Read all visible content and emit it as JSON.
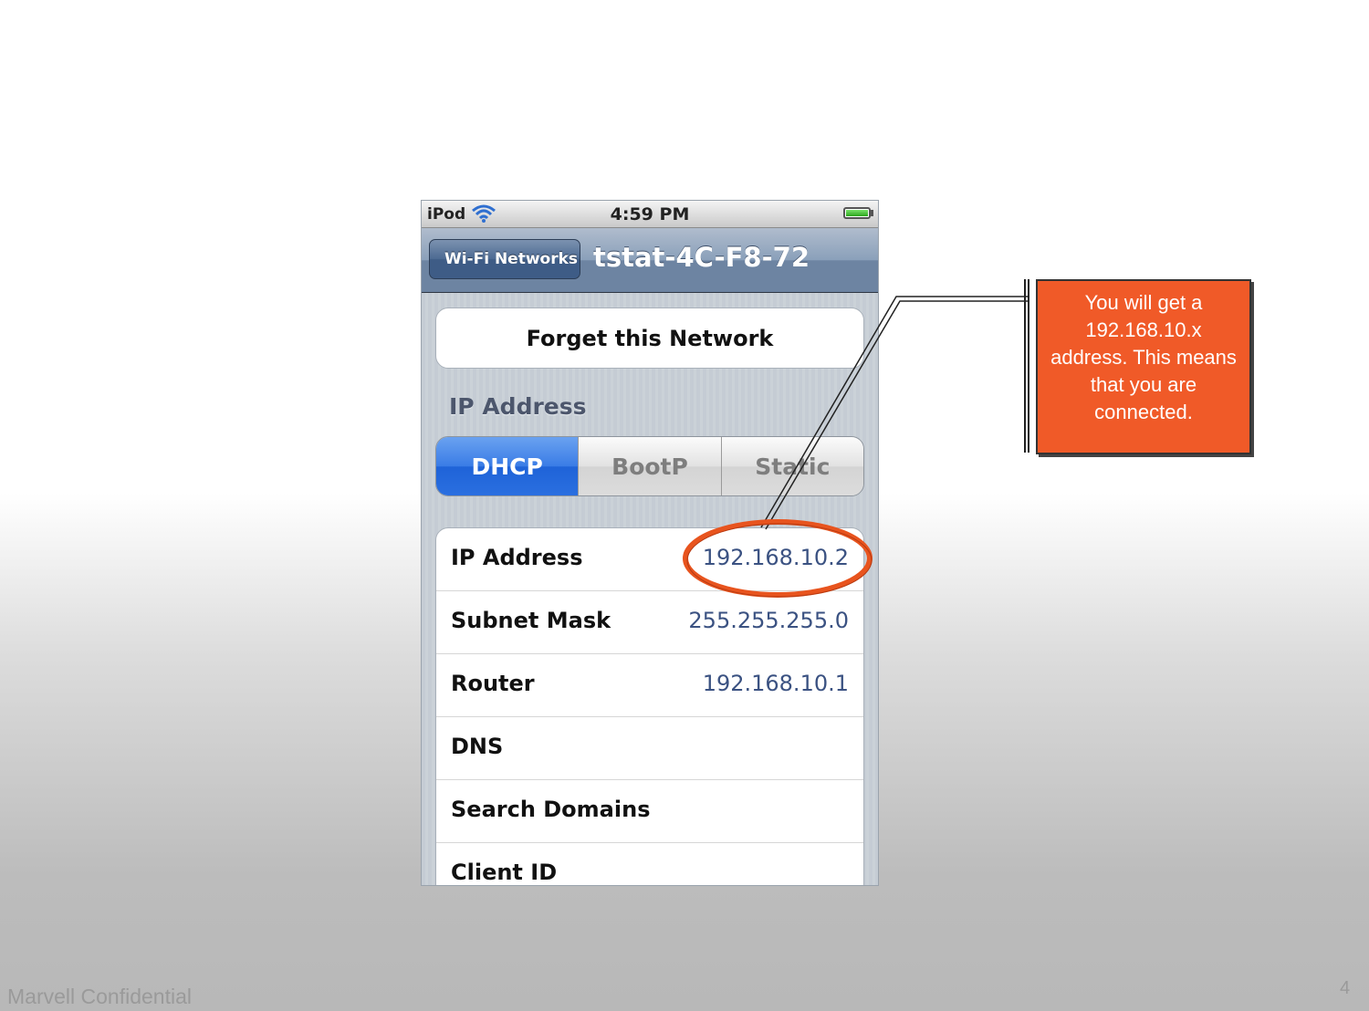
{
  "status_bar": {
    "carrier": "iPod",
    "time": "4:59 PM"
  },
  "nav": {
    "back_label": "Wi-Fi Networks",
    "title": "tstat-4C-F8-72"
  },
  "forget_button": "Forget this Network",
  "section_header": "IP Address",
  "segments": [
    {
      "label": "DHCP",
      "active": true
    },
    {
      "label": "BootP",
      "active": false
    },
    {
      "label": "Static",
      "active": false
    }
  ],
  "rows": [
    {
      "label": "IP Address",
      "value": "192.168.10.2"
    },
    {
      "label": "Subnet Mask",
      "value": "255.255.255.0"
    },
    {
      "label": "Router",
      "value": "192.168.10.1"
    },
    {
      "label": "DNS",
      "value": ""
    },
    {
      "label": "Search Domains",
      "value": ""
    },
    {
      "label": "Client ID",
      "value": ""
    }
  ],
  "callout": {
    "text": "You will get a 192.168.10.x address. This means that you are connected."
  },
  "footer": {
    "left": "Marvell Confidential",
    "page_number": "4"
  },
  "colors": {
    "callout": "#f05a28",
    "highlight_ellipse": "#e8541e",
    "active_segment": "#2a6fe0",
    "value_text": "#3b5282"
  },
  "icons": [
    "wifi-icon",
    "battery-icon",
    "back-arrow-icon"
  ]
}
